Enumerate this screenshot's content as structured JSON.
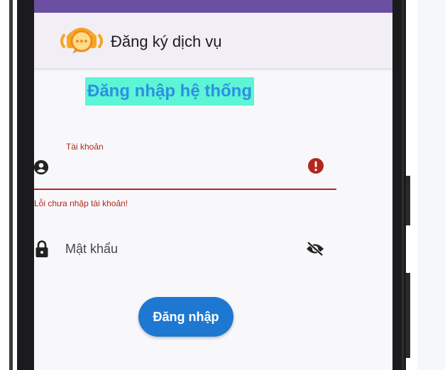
{
  "app_bar": {
    "title": "Đăng ký dịch vụ",
    "logo_icon": "chat-support-headset-icon"
  },
  "login_form": {
    "heading": "Đăng nhập hệ thống",
    "username": {
      "label": "Tài khoản",
      "value": "",
      "error": "Lỗi chưa nhập tài khoản!",
      "leading_icon": "account-circle-icon",
      "trailing_icon": "error-icon"
    },
    "password": {
      "placeholder": "Mật khẩu",
      "leading_icon": "lock-icon",
      "trailing_icon": "visibility-off-icon"
    },
    "submit_label": "Đăng nhập"
  },
  "colors": {
    "status_bar": "#6b4fa3",
    "app_bar": "#f2eef6",
    "heading_bg": "#5cf5d6",
    "heading_text": "#2f8fe0",
    "error": "#b3261e",
    "primary_button": "#1e78d2"
  }
}
